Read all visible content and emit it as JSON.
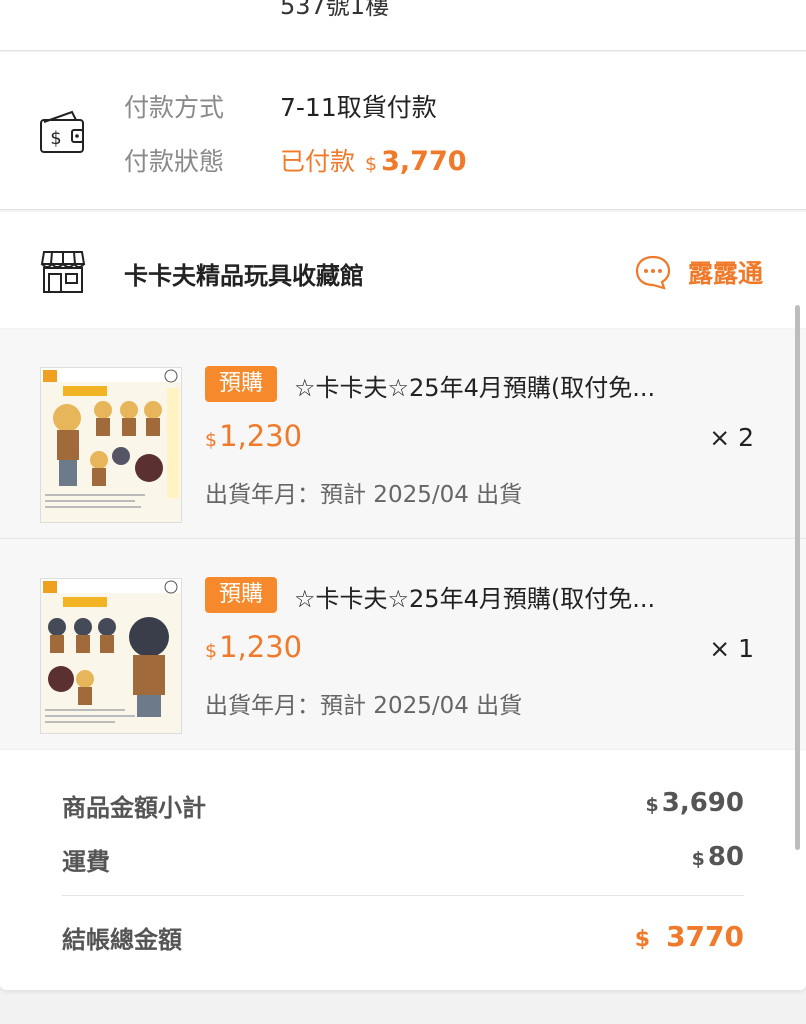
{
  "address": {
    "line": "537號1樓"
  },
  "payment": {
    "method_label": "付款方式",
    "method_value": "7-11取貨付款",
    "status_label": "付款狀態",
    "status_value": "已付款",
    "currency": "$",
    "amount": "3,770",
    "icon": "wallet-icon"
  },
  "shop": {
    "icon": "store-icon",
    "name": "卡卡夫精品玩具收藏館",
    "chat_icon": "chat-bubble-icon",
    "chat_label": "露露通"
  },
  "products": [
    {
      "tag": "預購",
      "name": "☆卡卡夫☆25年4月預購(取付免...",
      "currency": "$",
      "price": "1,230",
      "quantity": "× 2",
      "shipping": "出貨年月：預計 2025/04 出貨"
    },
    {
      "tag": "預購",
      "name": "☆卡卡夫☆25年4月預購(取付免...",
      "currency": "$",
      "price": "1,230",
      "quantity": "× 1",
      "shipping": "出貨年月：預計 2025/04 出貨"
    }
  ],
  "summary": {
    "subtotal_label": "商品金額小計",
    "subtotal_currency": "$",
    "subtotal_value": "3,690",
    "shipping_label": "運費",
    "shipping_currency": "$",
    "shipping_value": "80",
    "total_label": "結帳總金額",
    "total_currency": "$",
    "total_value": "3770"
  },
  "colors": {
    "accent": "#f07a2a",
    "tag_bg": "#f5892b"
  }
}
